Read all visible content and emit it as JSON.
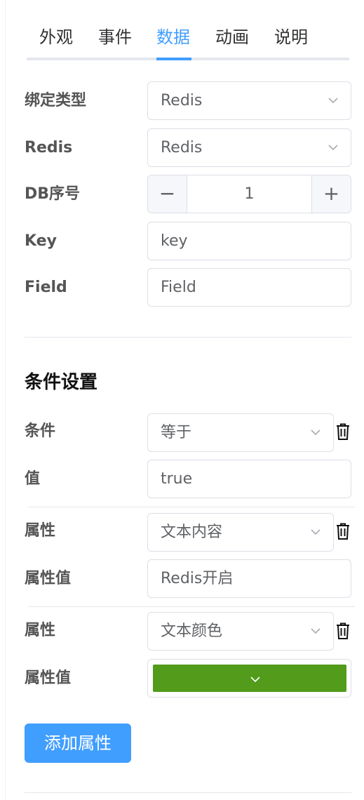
{
  "tabs": [
    "外观",
    "事件",
    "数据",
    "动画",
    "说明"
  ],
  "active_tab": "数据",
  "form": {
    "binding_type": {
      "label": "绑定类型",
      "value": "Redis"
    },
    "redis": {
      "label": "Redis",
      "value": "Redis"
    },
    "db_index": {
      "label": "DB序号",
      "value": "1",
      "minus": "−",
      "plus": "+"
    },
    "key": {
      "label": "Key",
      "value": "key"
    },
    "field": {
      "label": "Field",
      "value": "Field"
    }
  },
  "conditions": {
    "title": "条件设置",
    "condition": {
      "label": "条件",
      "value": "等于"
    },
    "value": {
      "label": "值",
      "value": "true"
    },
    "properties": [
      {
        "label": "属性",
        "value": "文本内容",
        "value_label": "属性值",
        "prop_value": "Redis开启"
      },
      {
        "label": "属性",
        "value": "文本颜色",
        "value_label": "属性值",
        "prop_color": "#529b1b"
      }
    ],
    "add_button": "添加属性"
  },
  "colors": {
    "accent": "#409eff",
    "swatch": "#529b1b"
  },
  "icons": {
    "dropdown": "chevron-down-icon",
    "delete": "trash-icon"
  }
}
